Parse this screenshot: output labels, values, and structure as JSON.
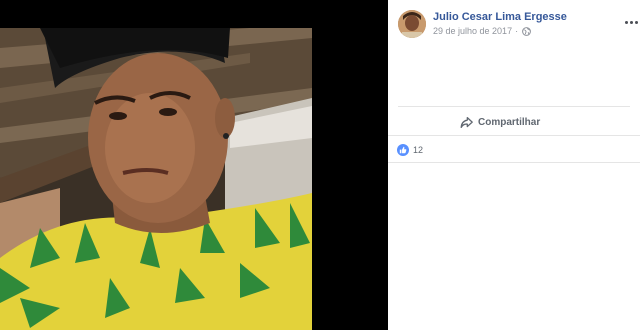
{
  "post": {
    "author": "Julio Cesar Lima Ergesse",
    "date": "29 de julho de 2017",
    "separator": "·",
    "privacy_icon": "globe-icon",
    "share_label": "Compartilhar",
    "reaction_icon": "like-icon",
    "reaction_count": "12"
  },
  "colors": {
    "link": "#365899",
    "meta": "#90949c",
    "like": "#5890ff",
    "photo_background": "#000000"
  }
}
